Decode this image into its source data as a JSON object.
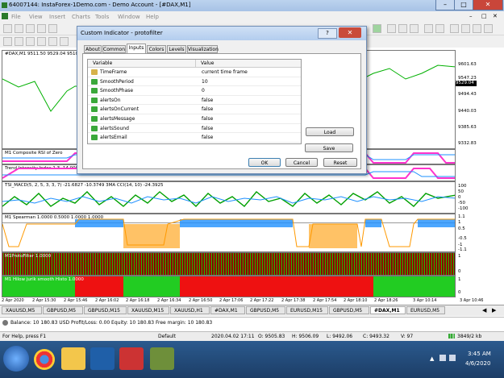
{
  "window": {
    "title": "64007144: InstaForex-1Demo.com - Demo Account - [#DAX,M1]"
  },
  "menu": [
    "File",
    "View",
    "Insert",
    "Charts",
    "Tools",
    "Window",
    "Help"
  ],
  "chart": {
    "header": "#DAX,M1  9511.50 9529.04 9510",
    "price_ticks": [
      "9601.63",
      "9547.23",
      "9494.43",
      "9440.03",
      "9385.63",
      "9332.83"
    ],
    "current_price": "9529.04",
    "time_ticks": [
      "2 Apr 2020",
      "2 Apr 15:30",
      "2 Apr 15:46",
      "2 Apr 16:02",
      "2 Apr 16:18",
      "2 Apr 16:34",
      "2 Apr 16:50",
      "2 Apr 17:06",
      "2 Apr 17:22",
      "2 Apr 17:38",
      "2 Apr 17:54",
      "2 Apr 18:10",
      "2 Apr 18:26",
      "3 Apr 10:14",
      "3 Apr 10:46"
    ],
    "panels": [
      {
        "label": "M1 Composite RSI of Zero",
        "ticks": []
      },
      {
        "label": "Trend Intensity Index 1.3 -14.0000 -5",
        "ticks": []
      },
      {
        "label": "TSI_MACD(5, 2, 5, 3, 3, 7) -21.6827 -10.3749  3MA CCI(14, 10) -24.3925",
        "ticks": [
          "100",
          "50",
          "0",
          "-50",
          "-100"
        ]
      },
      {
        "label": "M1 Spearman  1.0000 0.5000 1.0000 1.0000",
        "ticks": [
          "1.1",
          "1",
          "0.5",
          "-0.5",
          "-1",
          "-1.1"
        ]
      },
      {
        "label": "M1ProtoFilter 1.0000",
        "ticks": [
          "1",
          "0"
        ]
      },
      {
        "label": "M1 Hilow jurik smooth Histo 1.0000",
        "ticks": [
          "1",
          "0"
        ]
      }
    ]
  },
  "dialog": {
    "title": "Custom Indicator - protofilter",
    "close": "✕",
    "tabs": [
      "About",
      "Common",
      "Inputs",
      "Colors",
      "Levels",
      "Visualization"
    ],
    "active_tab": "Inputs",
    "col_variable": "Variable",
    "col_value": "Value",
    "rows": [
      {
        "name": "TimeFrame",
        "value": "current time frame",
        "icon": "ab"
      },
      {
        "name": "SmoothPeriod",
        "value": "10",
        "icon": "num"
      },
      {
        "name": "SmoothPhase",
        "value": "0",
        "icon": "num"
      },
      {
        "name": "alertsOn",
        "value": "false",
        "icon": "bool"
      },
      {
        "name": "alertsOnCurrent",
        "value": "false",
        "icon": "bool"
      },
      {
        "name": "alertsMessage",
        "value": "false",
        "icon": "bool"
      },
      {
        "name": "alertsSound",
        "value": "false",
        "icon": "bool"
      },
      {
        "name": "alertsEmail",
        "value": "false",
        "icon": "bool"
      }
    ],
    "load": "Load",
    "save": "Save",
    "ok": "OK",
    "cancel": "Cancel",
    "reset": "Reset"
  },
  "tabs": [
    "XAUUSD,M5",
    "GBPUSD,M5",
    "GBPUSD,M15",
    "XAUUSD,M15",
    "XAUUSD,H1",
    "#DAX,M1",
    "GBPUSD,M5",
    "EURUSD,M15",
    "GBPUSD,M5",
    "#DAX,M1",
    "EURUSD,M5"
  ],
  "active_tab_index": 9,
  "balance": {
    "text": "Balance: 10 180.83 USD  Profit/Loss: 0.00  Equity: 10 180.83  Free margin: 10 180.83"
  },
  "status": {
    "help": "For Help, press F1",
    "profile": "Default",
    "datetime": "2020.04.02 17:11",
    "open": "O: 9505.83",
    "high": "H: 9506.09",
    "low": "L: 9492.06",
    "close": "C: 9493.32",
    "volume": "V: 97",
    "traffic": "3849/2 kb"
  },
  "taskbar": {
    "time": "3:45 AM",
    "date": "4/6/2020"
  },
  "colors": {
    "accent": "#1e90ff",
    "green": "#22cc22",
    "red": "#ee1111",
    "pink": "#ff33cc",
    "orange": "#ff9900"
  }
}
